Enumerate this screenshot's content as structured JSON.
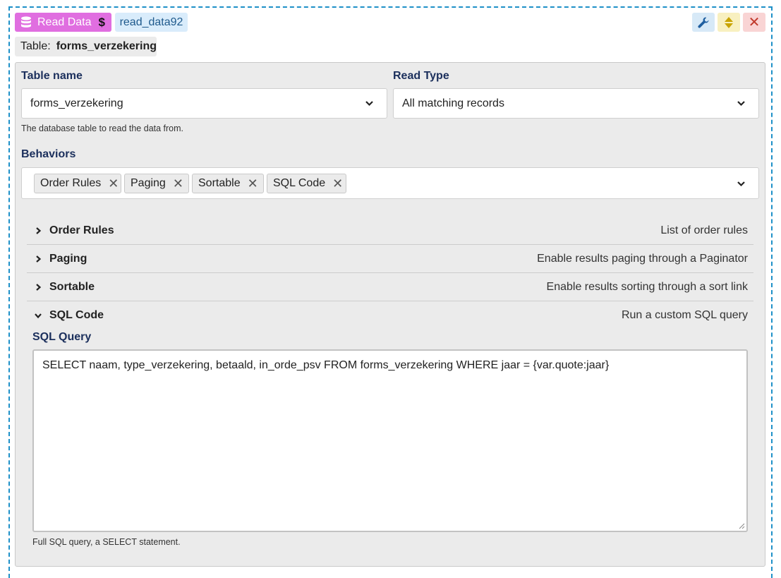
{
  "header": {
    "badge_label": "Read Data",
    "badge_symbol": "$",
    "id_label": "read_data92",
    "icons": [
      "database-icon",
      "wrench-icon",
      "up-down-icon",
      "close-icon"
    ]
  },
  "table_chip": {
    "prefix": "Table:",
    "value": "forms_verzekering"
  },
  "fields": {
    "table_name": {
      "label": "Table name",
      "value": "forms_verzekering",
      "help": "The database table to read the data from."
    },
    "read_type": {
      "label": "Read Type",
      "value": "All matching records"
    }
  },
  "behaviors": {
    "label": "Behaviors",
    "tags": [
      "Order Rules",
      "Paging",
      "Sortable",
      "SQL Code"
    ]
  },
  "sections": [
    {
      "title": "Order Rules",
      "desc": "List of order rules",
      "expanded": false
    },
    {
      "title": "Paging",
      "desc": "Enable results paging through a Paginator",
      "expanded": false
    },
    {
      "title": "Sortable",
      "desc": "Enable results sorting through a sort link",
      "expanded": false
    },
    {
      "title": "SQL Code",
      "desc": "Run a custom SQL query",
      "expanded": true
    }
  ],
  "sql": {
    "label": "SQL Query",
    "value": "SELECT naam, type_verzekering, betaald, in_orde_psv FROM forms_verzekering WHERE jaar = {var.quote:jaar}",
    "help": "Full SQL query, a SELECT statement."
  },
  "colors": {
    "badge": "#e06ee0",
    "id_chip": "#d9ecfb",
    "frame_border": "#1e90c8",
    "label": "#1b2f5c"
  }
}
